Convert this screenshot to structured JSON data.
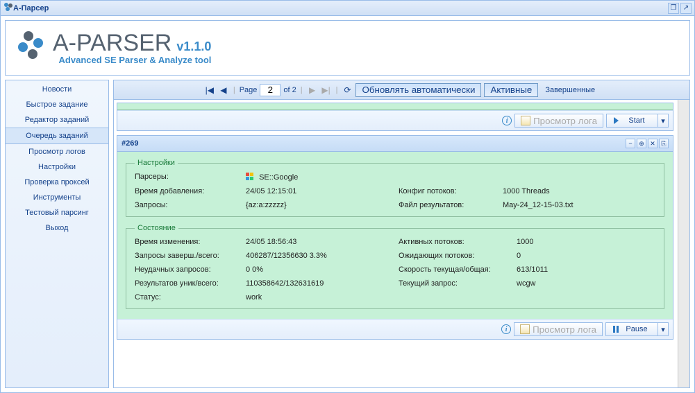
{
  "window": {
    "title": "А-Парсер"
  },
  "brand": {
    "name": "A-PARSER",
    "version": "v1.1.0",
    "tagline": "Advanced SE Parser & Analyze tool"
  },
  "sidebar": {
    "items": [
      {
        "label": "Новости"
      },
      {
        "label": "Быстрое задание"
      },
      {
        "label": "Редактор заданий"
      },
      {
        "label": "Очередь заданий"
      },
      {
        "label": "Просмотр логов"
      },
      {
        "label": "Настройки"
      },
      {
        "label": "Проверка проксей"
      },
      {
        "label": "Инструменты"
      },
      {
        "label": "Тестовый парсинг"
      },
      {
        "label": "Выход"
      }
    ],
    "activeIndex": 3
  },
  "toolbar": {
    "page_label": "Page",
    "page_current": "2",
    "page_of": "of 2",
    "auto_refresh": "Обновлять автоматически",
    "active": "Активные",
    "completed": "Завершенные"
  },
  "prev_card": {
    "log_label": "Просмотр лога",
    "action_label": "Start"
  },
  "task": {
    "id": "#269",
    "settings_legend": "Настройки",
    "state_legend": "Состояние",
    "labels": {
      "parsers": "Парсеры:",
      "added": "Время добавления:",
      "queries": "Запросы:",
      "thread_config": "Конфиг потоков:",
      "result_file": "Файл результатов:",
      "changed": "Время изменения:",
      "queries_done": "Запросы заверш./всего:",
      "failed": "Неудачных запросов:",
      "results": "Результатов уник/всего:",
      "status_l": "Статус:",
      "active_threads": "Активных потоков:",
      "waiting_threads": "Ожидающих потоков:",
      "speed": "Скорость текущая/общая:",
      "current_query": "Текущий запрос:"
    },
    "values": {
      "parser_name": "SE::Google",
      "added": "24/05 12:15:01",
      "queries": "{az:a:zzzzz}",
      "thread_config": "1000 Threads",
      "result_file": "May-24_12-15-03.txt",
      "changed": "24/05 18:56:43",
      "queries_done": "406287/12356630 3.3%",
      "failed": "0 0%",
      "results": "110358642/132631619",
      "status": "work",
      "active_threads": "1000",
      "waiting_threads": "0",
      "speed": "613/1011",
      "current_query": "wcgw"
    },
    "footer": {
      "log_label": "Просмотр лога",
      "action_label": "Pause"
    }
  }
}
